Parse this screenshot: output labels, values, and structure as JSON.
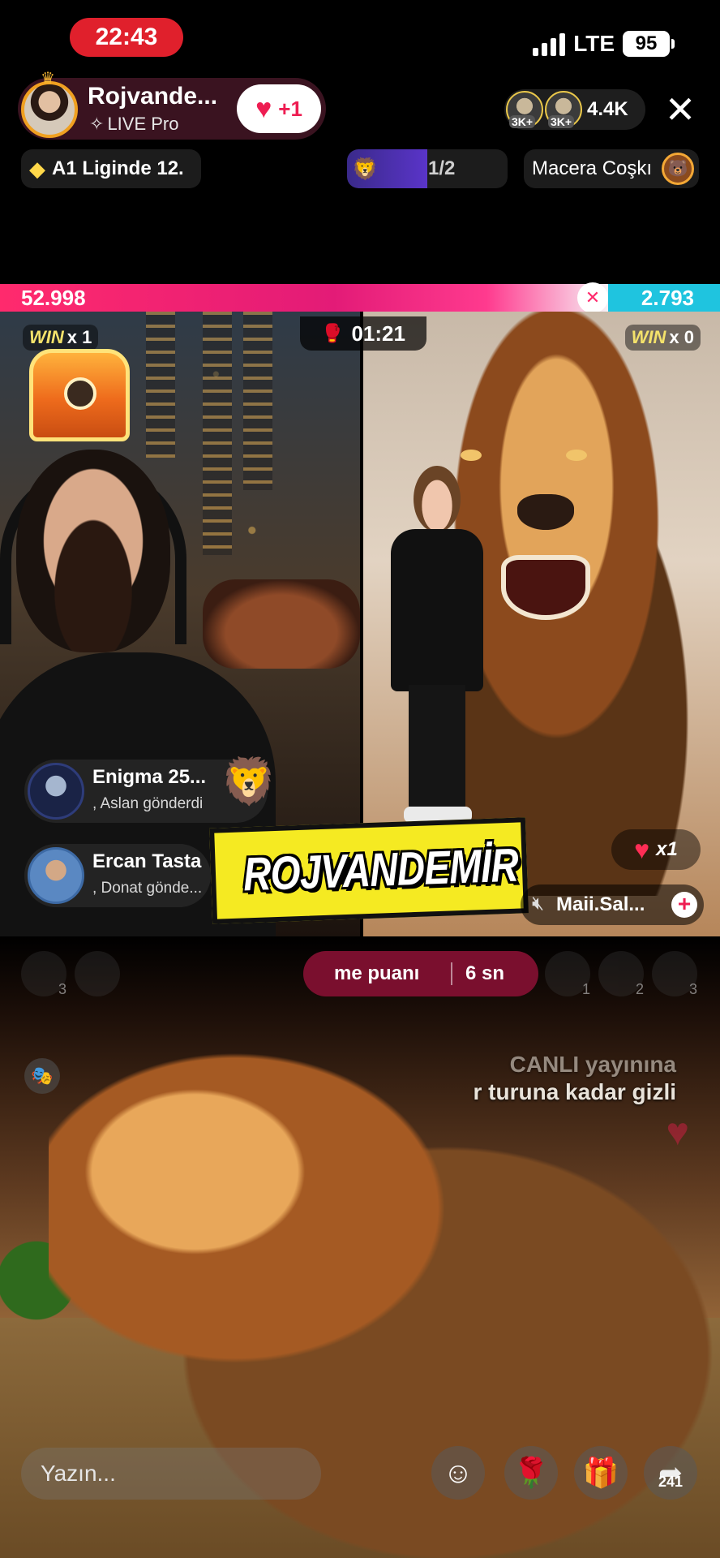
{
  "status_bar": {
    "time": "22:43",
    "network": "LTE",
    "battery": "95"
  },
  "host": {
    "name": "Rojvande...",
    "subtitle": "LIVE Pro",
    "follow_icon": "heart-icon",
    "follow_label": "+1"
  },
  "viewers": {
    "badge_1": "3K+",
    "badge_2": "3K+",
    "count": "4.4K"
  },
  "chips": {
    "league": "A1 Liginde 12.",
    "rank_progress": "1/2",
    "rank_fill_fraction": 0.5,
    "adventure": "Macera Coşkı"
  },
  "battle": {
    "left_score": "52.998",
    "right_score": "2.793",
    "separator_glyph": "✕",
    "timer": "01:21",
    "left_win_label": "WIN",
    "left_win_count": "x 1",
    "right_win_label": "WIN",
    "right_win_count": "x 0",
    "like_multiplier": "x1",
    "opponent_name": "Maii.Sal..."
  },
  "gifts": [
    {
      "user": "Enigma 25...",
      "action": ", Aslan  gönderdi"
    },
    {
      "user": "Ercan Tasta",
      "action": ", Donat  gönde..."
    }
  ],
  "overlay_logo": "ROJVANDEMİR",
  "score_bar": {
    "label": "me puanı",
    "time": "6 sn",
    "ranks": [
      "3",
      "1",
      "2",
      "3"
    ]
  },
  "chat": {
    "line_1": "CANLI yayınına",
    "line_2": "r turuna kadar gizli"
  },
  "bottom_bar": {
    "placeholder": "Yazın...",
    "share_count": "241"
  },
  "colors": {
    "accent": "#ee1d52",
    "battle_left": "#ff2a6d",
    "battle_right": "#1fc4df",
    "logo_yellow": "#f5ea22"
  }
}
